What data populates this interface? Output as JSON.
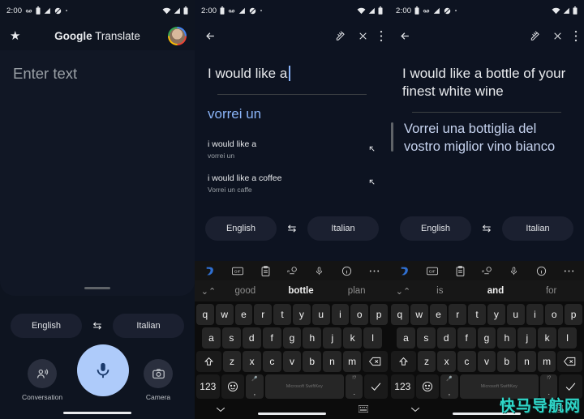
{
  "statusbar": {
    "time": "2:00",
    "left_icons": [
      "voicemail-icon",
      "battery-saver-icon",
      "signal-alert-icon",
      "dnd-icon",
      "dot-icon"
    ],
    "right_icons": [
      "wifi-icon",
      "cellular-icon",
      "battery-icon"
    ]
  },
  "panel1": {
    "appbar": {
      "star_icon": "star-icon",
      "title_bold": "Google",
      "title_light": "Translate",
      "avatar": "account-avatar"
    },
    "input_placeholder": "Enter text",
    "language": {
      "source": "English",
      "swap_icon": "swap-languages-icon",
      "target": "Italian"
    },
    "actions": [
      {
        "label": "Conversation",
        "icon": "conversation-icon"
      },
      {
        "label": "",
        "icon": "microphone-icon"
      },
      {
        "label": "Camera",
        "icon": "camera-icon"
      }
    ]
  },
  "panel2": {
    "appbar": {
      "back_icon": "back-arrow-icon",
      "handwrite_icon": "handwriting-icon",
      "close_icon": "close-icon",
      "more_icon": "more-vert-icon"
    },
    "source_text": "I would like a",
    "live_translation": "vorrei un",
    "suggestions": [
      {
        "main": "i would like a",
        "sub": "vorrei un",
        "icon": "insert-arrow-icon"
      },
      {
        "main": "i would like a coffee",
        "sub": "Vorrei un caffe",
        "icon": "insert-arrow-icon"
      }
    ],
    "language": {
      "source": "English",
      "swap_icon": "swap-languages-icon",
      "target": "Italian"
    },
    "keyboard": {
      "toolbar_icons": [
        "swiftkey-logo-icon",
        "gif-icon",
        "clipboard-icon",
        "translator-icon",
        "microphone-icon",
        "info-icon",
        "more-icon"
      ],
      "expand_icon": "expand-suggestions-icon",
      "suggestions": [
        "good",
        "bottle",
        "plan"
      ],
      "bold_index": 1,
      "row1": [
        "q",
        "w",
        "e",
        "r",
        "t",
        "y",
        "u",
        "i",
        "o",
        "p"
      ],
      "row2": [
        "a",
        "s",
        "d",
        "f",
        "g",
        "h",
        "j",
        "k",
        "l"
      ],
      "row3_shift": "shift-icon",
      "row3": [
        "z",
        "x",
        "c",
        "v",
        "b",
        "n",
        "m"
      ],
      "row3_backspace": "backspace-icon",
      "numeric_key": "123",
      "emoji_key": "emoji-icon",
      "comma_key_top": "microphone-icon",
      "comma_key_bottom": ",",
      "space_label": "Microsoft SwiftKey",
      "period_key_top": "!?",
      "period_key_bottom": ".",
      "enter_key": "enter-checkmark-icon",
      "nav_down_icon": "collapse-keyboard-icon",
      "nav_switch_icon": "keyboard-switcher-icon"
    }
  },
  "panel3": {
    "appbar": {
      "back_icon": "back-arrow-icon",
      "handwrite_icon": "handwriting-icon",
      "close_icon": "close-icon",
      "more_icon": "more-vert-icon"
    },
    "source_text": "I would like a bottle of your finest white wine",
    "translation": "Vorrei una bottiglia del vostro miglior vino bianco",
    "language": {
      "source": "English",
      "swap_icon": "swap-languages-icon",
      "target": "Italian"
    },
    "keyboard": {
      "toolbar_icons": [
        "swiftkey-logo-icon",
        "gif-icon",
        "clipboard-icon",
        "translator-icon",
        "microphone-icon",
        "info-icon",
        "more-icon"
      ],
      "expand_icon": "expand-suggestions-icon",
      "suggestions": [
        "is",
        "and",
        "for"
      ],
      "bold_index": 1,
      "row1": [
        "q",
        "w",
        "e",
        "r",
        "t",
        "y",
        "u",
        "i",
        "o",
        "p"
      ],
      "row2": [
        "a",
        "s",
        "d",
        "f",
        "g",
        "h",
        "j",
        "k",
        "l"
      ],
      "row3_shift": "shift-icon",
      "row3": [
        "z",
        "x",
        "c",
        "v",
        "b",
        "n",
        "m"
      ],
      "row3_backspace": "backspace-icon",
      "numeric_key": "123",
      "emoji_key": "emoji-icon",
      "comma_key_top": "microphone-icon",
      "comma_key_bottom": ",",
      "space_label": "Microsoft SwiftKey",
      "period_key_top": "!?",
      "period_key_bottom": ".",
      "enter_key": "enter-checkmark-icon",
      "nav_down_icon": "collapse-keyboard-icon",
      "nav_switch_icon": "keyboard-switcher-icon"
    }
  },
  "watermark": {
    "text": "快马导航网",
    "color": "#2fd6c8"
  }
}
